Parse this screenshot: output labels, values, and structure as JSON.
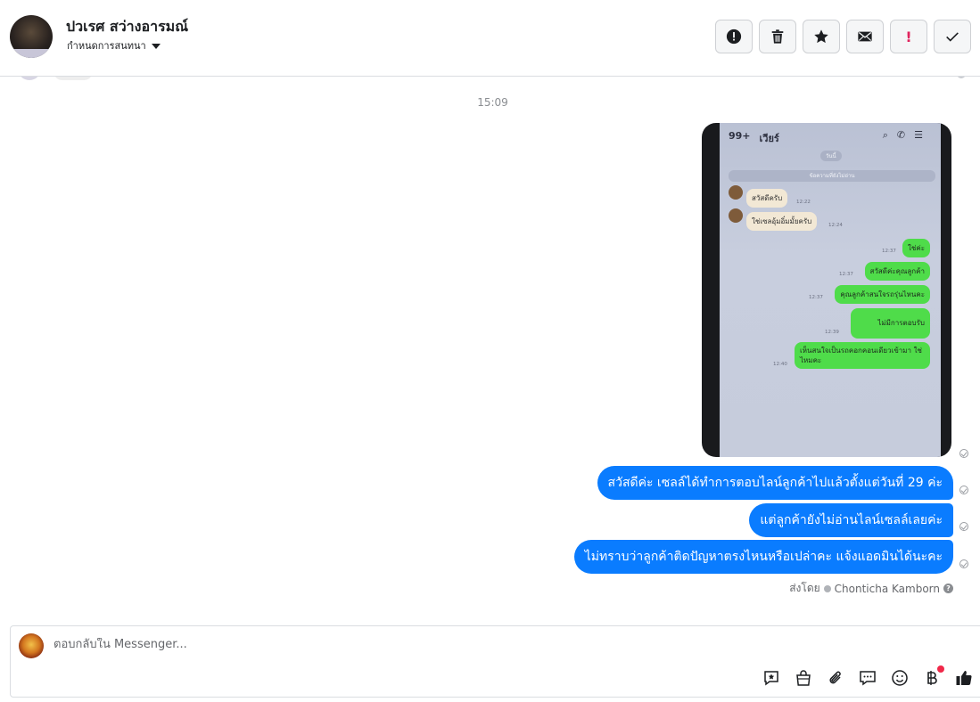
{
  "header": {
    "contact_name": "ปวเรศ สว่างอารมณ์",
    "conversation_status": "กำหนดการสนทนา",
    "actions": [
      {
        "name": "spam-alert-button",
        "icon": "alert-circle-icon"
      },
      {
        "name": "delete-button",
        "icon": "trash-icon"
      },
      {
        "name": "star-button",
        "icon": "star-icon"
      },
      {
        "name": "mark-unread-button",
        "icon": "envelope-icon"
      },
      {
        "name": "follow-up-button",
        "label": "!"
      },
      {
        "name": "mark-done-button",
        "icon": "check-icon"
      }
    ]
  },
  "chat": {
    "timestamp": "15:09",
    "screenshot_image": {
      "top_back": "99+",
      "top_name": "เวียร์",
      "today_pill": "วันนี้",
      "unread_banner": "ข้อความที่ยังไม่อ่าน",
      "incoming": [
        {
          "text": "สวัสดีครับ",
          "time": "12:22"
        },
        {
          "text": "ใช่เซลอุ้มอิ๋มมั้ยครับ",
          "time": "12:24"
        }
      ],
      "outgoing": [
        {
          "text": "ใช่ค่ะ",
          "time": "12:37"
        },
        {
          "text": "สวัสดีค่ะคุณลูกค้า",
          "time": "12:37"
        },
        {
          "text": "คุณลูกค้าสนใจรถรุ่นไหนคะ",
          "time": "12:37"
        },
        {
          "text": "ไม่มีการตอบรับ",
          "time": "12:39"
        },
        {
          "text": "เห็นสนใจเป็นรถคอกคอนเดียวเข้ามา ใช่ไหมคะ",
          "time": "12:40"
        }
      ]
    },
    "messages": [
      {
        "text": "สวัสดีค่ะ เซลล์ได้ทำการตอบไลน์ลูกค้าไปแล้วตั้งแต่วันที่ 29 ค่ะ"
      },
      {
        "text": "แต่ลูกค้ายังไม่อ่านไลน์เซลล์เลยค่ะ"
      },
      {
        "text": "ไม่ทราบว่าลูกค้าติดปัญหาตรงไหนหรือเปล่าคะ แจ้งแอดมินได้นะคะ"
      }
    ],
    "sent_by_label": "ส่งโดย",
    "sent_by_name": "Chonticha Kamborn",
    "sent_by_help": "?"
  },
  "composer": {
    "placeholder": "ตอบกลับใน Messenger...",
    "tools": [
      "saved-reply-icon",
      "shopping-bag-icon",
      "paperclip-icon",
      "chat-bubbles-icon",
      "emoji-icon",
      "baht-icon",
      "thumbs-up-icon"
    ]
  },
  "colors": {
    "bubble": "#0a7cff",
    "line_green": "#4fdc4a",
    "notification": "#f02849"
  }
}
